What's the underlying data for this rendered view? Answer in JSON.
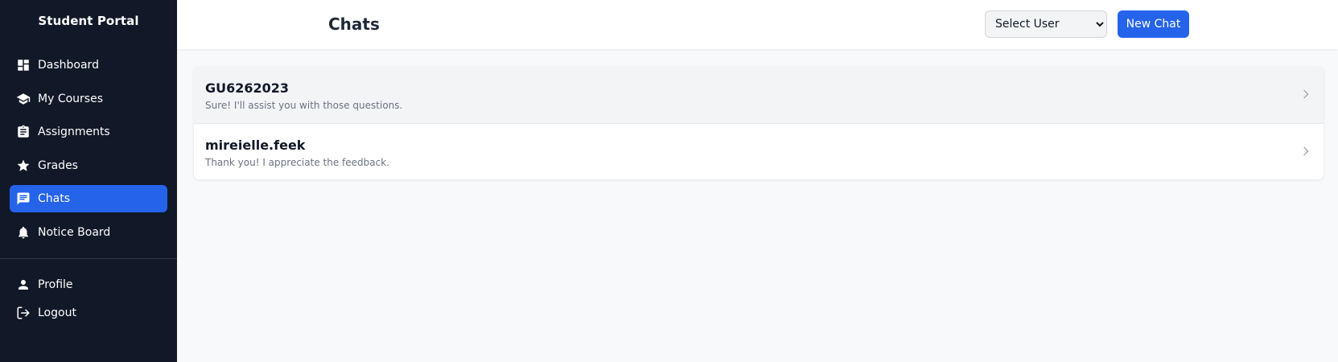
{
  "sidebar": {
    "brand": "Student Portal",
    "items": [
      {
        "label": "Dashboard",
        "icon": "dashboard-icon"
      },
      {
        "label": "My Courses",
        "icon": "school-icon"
      },
      {
        "label": "Assignments",
        "icon": "clipboard-icon"
      },
      {
        "label": "Grades",
        "icon": "star-icon"
      },
      {
        "label": "Chats",
        "icon": "chat-icon",
        "active": true
      },
      {
        "label": "Notice Board",
        "icon": "bell-icon"
      }
    ],
    "bottom_items": [
      {
        "label": "Profile",
        "icon": "person-icon"
      },
      {
        "label": "Logout",
        "icon": "logout-icon"
      }
    ]
  },
  "header": {
    "title": "Chats",
    "user_select": {
      "selected": "Select User"
    },
    "new_chat_label": "New Chat"
  },
  "chats": [
    {
      "name": "GU6262023",
      "preview": "Sure! I'll assist you with those questions."
    },
    {
      "name": "mireielle.feek",
      "preview": "Thank you! I appreciate the feedback."
    }
  ],
  "colors": {
    "sidebar_bg": "#111827",
    "accent": "#2563eb",
    "page_bg": "#f8f9fb"
  }
}
